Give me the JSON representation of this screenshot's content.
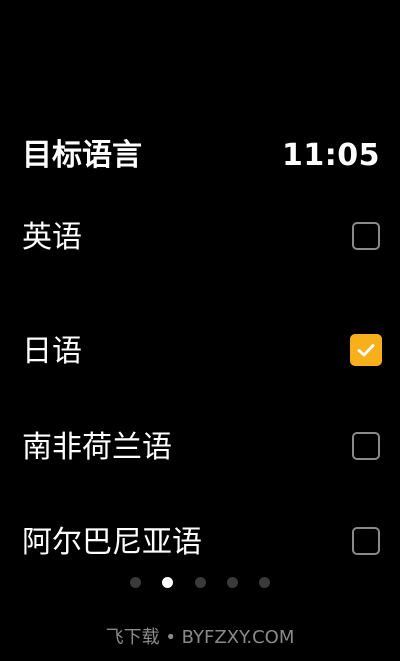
{
  "header": {
    "title": "目标语言",
    "time": "11:05"
  },
  "languages": [
    {
      "label": "英语",
      "checked": false
    },
    {
      "label": "日语",
      "checked": true
    },
    {
      "label": "南非荷兰语",
      "checked": false
    },
    {
      "label": "阿尔巴尼亚语",
      "checked": false
    }
  ],
  "pager": {
    "total": 5,
    "active_index": 1
  },
  "watermark": "飞下载 • BYFZXY.COM",
  "colors": {
    "background": "#000000",
    "text": "#ffffff",
    "accent": "#f7b01b",
    "checkbox_border": "#8a8a8a",
    "dot_inactive": "#3a3a3a",
    "watermark": "#8a8a8a"
  },
  "icons": {
    "checked": "checkmark-icon"
  }
}
